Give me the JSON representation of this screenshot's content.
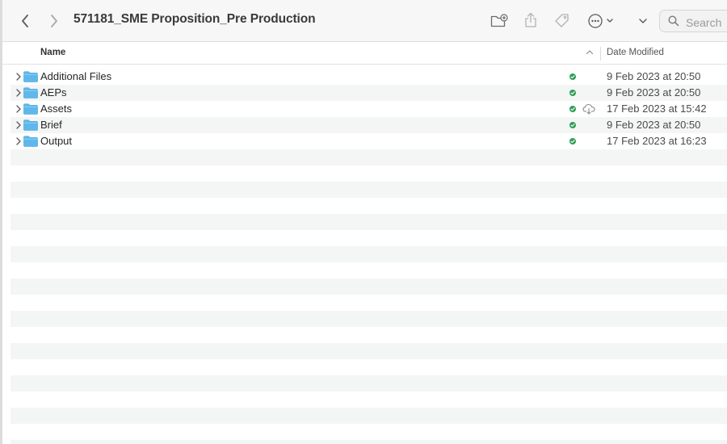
{
  "toolbar": {
    "back_icon": "chevron-left-icon",
    "forward_icon": "chevron-right-icon",
    "title": "571181_SME Proposition_Pre Production",
    "new_folder_icon": "new-folder-icon",
    "share_icon": "share-icon",
    "tag_icon": "tag-icon",
    "more_icon": "ellipsis-circle-icon",
    "overflow_icon": "chevron-down-icon",
    "search_placeholder": "Search"
  },
  "columns": {
    "name": "Name",
    "date_modified": "Date Modified",
    "sort_icon": "chevron-up-icon"
  },
  "files": [
    {
      "name": "Additional Files",
      "status": "synced",
      "cloud": false,
      "date": "9 Feb 2023 at 20:50"
    },
    {
      "name": "AEPs",
      "status": "synced",
      "cloud": false,
      "date": "9 Feb 2023 at 20:50"
    },
    {
      "name": "Assets",
      "status": "synced",
      "cloud": true,
      "date": "17 Feb 2023 at 15:42"
    },
    {
      "name": "Brief",
      "status": "synced",
      "cloud": false,
      "date": "9 Feb 2023 at 20:50"
    },
    {
      "name": "Output",
      "status": "synced",
      "cloud": false,
      "date": "17 Feb 2023 at 16:23"
    }
  ],
  "colors": {
    "folder": "#5fb8ec",
    "sync_ok": "#2f9e55",
    "row_alt": "#f4f5f5"
  }
}
